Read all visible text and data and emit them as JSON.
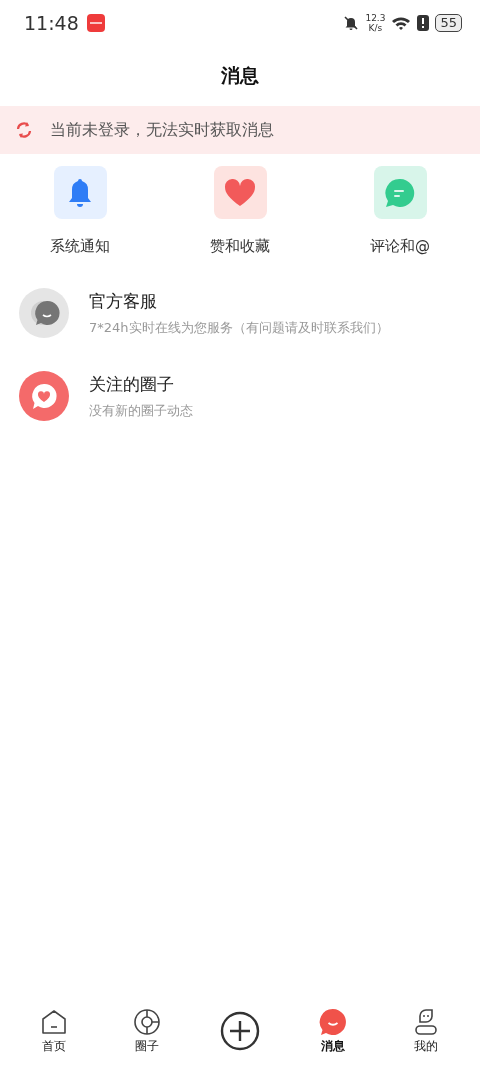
{
  "status_bar": {
    "time": "11:48",
    "speed_value": "12.3",
    "speed_unit": "K/s",
    "battery": "55"
  },
  "header": {
    "title": "消息"
  },
  "login_banner": {
    "text": "当前未登录，无法实时获取消息"
  },
  "quick_actions": [
    {
      "kind": "bell",
      "label": "系统通知"
    },
    {
      "kind": "heart",
      "label": "赞和收藏"
    },
    {
      "kind": "comment",
      "label": "评论和@"
    }
  ],
  "conversations": [
    {
      "kind": "service",
      "title": "官方客服",
      "subtitle": "7*24h实时在线为您服务（有问题请及时联系我们）"
    },
    {
      "kind": "circle",
      "title": "关注的圈子",
      "subtitle": "没有新的圈子动态"
    }
  ],
  "bottom_nav": [
    {
      "kind": "home",
      "label": "首页",
      "selected": false
    },
    {
      "kind": "circles",
      "label": "圈子",
      "selected": false
    },
    {
      "kind": "add"
    },
    {
      "kind": "messages",
      "label": "消息",
      "selected": true
    },
    {
      "kind": "profile",
      "label": "我的",
      "selected": false
    }
  ]
}
